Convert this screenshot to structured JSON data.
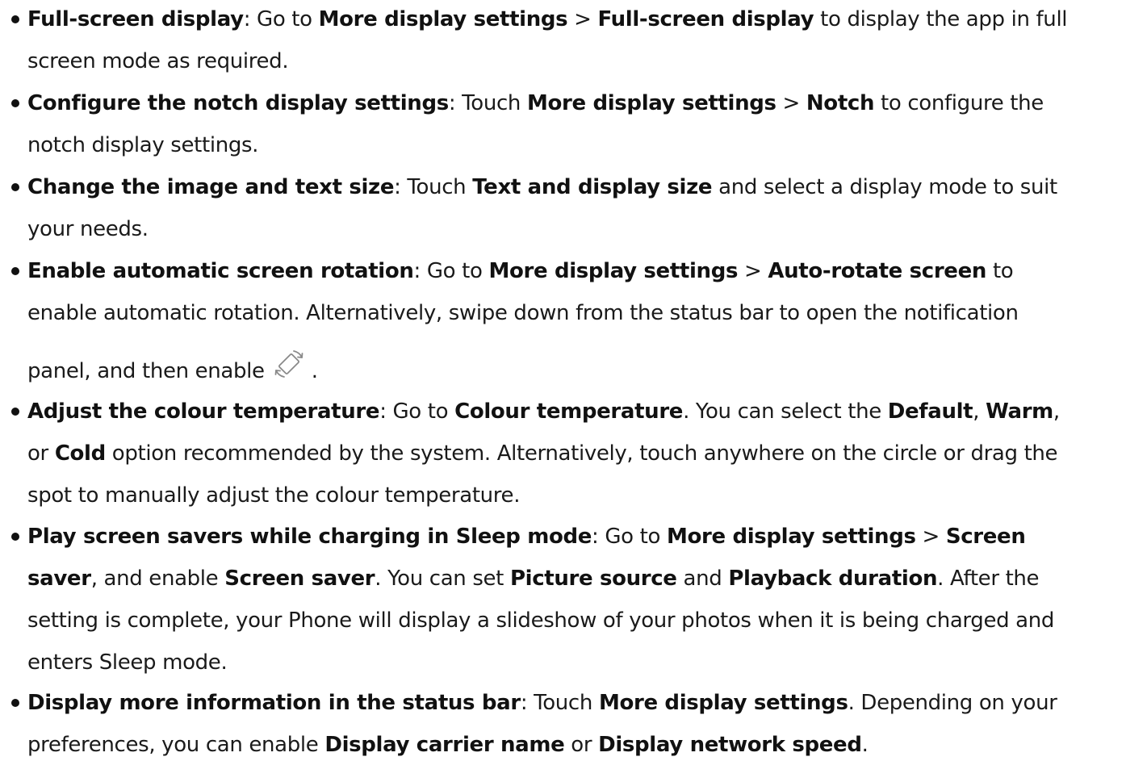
{
  "items": [
    {
      "id": "full-screen",
      "lines": [
        [
          {
            "t": "Full-screen display",
            "b": true
          },
          {
            "t": ": Go to "
          },
          {
            "t": "More display settings",
            "b": true
          },
          {
            "t": " > "
          },
          {
            "t": "Full-screen display",
            "b": true
          },
          {
            "t": " to display the app in full"
          }
        ],
        [
          {
            "t": "screen mode as required."
          }
        ]
      ]
    },
    {
      "id": "notch",
      "lines": [
        [
          {
            "t": "Configure the notch display settings",
            "b": true
          },
          {
            "t": ": Touch "
          },
          {
            "t": "More display settings",
            "b": true
          },
          {
            "t": " > "
          },
          {
            "t": "Notch",
            "b": true
          },
          {
            "t": " to configure the"
          }
        ],
        [
          {
            "t": "notch display settings."
          }
        ]
      ]
    },
    {
      "id": "text-size",
      "lines": [
        [
          {
            "t": "Change the image and text size",
            "b": true
          },
          {
            "t": ": Touch "
          },
          {
            "t": "Text and display size",
            "b": true
          },
          {
            "t": " and select a display mode to suit"
          }
        ],
        [
          {
            "t": "your needs."
          }
        ]
      ]
    },
    {
      "id": "auto-rotate",
      "lines": [
        [
          {
            "t": "Enable automatic screen rotation",
            "b": true
          },
          {
            "t": ": Go to "
          },
          {
            "t": "More display settings",
            "b": true
          },
          {
            "t": " > "
          },
          {
            "t": "Auto-rotate screen",
            "b": true
          },
          {
            "t": " to"
          }
        ],
        [
          {
            "t": "enable automatic rotation. Alternatively, swipe down from the status bar to open the notification"
          }
        ],
        [
          {
            "t": "panel, and then enable"
          },
          {
            "icon": "auto-rotate-icon"
          },
          {
            "t": "."
          }
        ]
      ]
    },
    {
      "id": "colour-temp",
      "lines": [
        [
          {
            "t": "Adjust the colour temperature",
            "b": true
          },
          {
            "t": ": Go to "
          },
          {
            "t": "Colour temperature",
            "b": true
          },
          {
            "t": ". You can select the "
          },
          {
            "t": "Default",
            "b": true
          },
          {
            "t": ", "
          },
          {
            "t": "Warm",
            "b": true
          },
          {
            "t": ","
          }
        ],
        [
          {
            "t": "or "
          },
          {
            "t": "Cold",
            "b": true
          },
          {
            "t": " option recommended by the system. Alternatively, touch anywhere on the circle or drag the"
          }
        ],
        [
          {
            "t": "spot to manually adjust the colour temperature."
          }
        ]
      ]
    },
    {
      "id": "screen-saver",
      "lines": [
        [
          {
            "t": "Play screen savers while charging in Sleep mode",
            "b": true
          },
          {
            "t": ": Go to "
          },
          {
            "t": "More display settings",
            "b": true
          },
          {
            "t": " > "
          },
          {
            "t": "Screen",
            "b": true
          }
        ],
        [
          {
            "t": "saver",
            "b": true
          },
          {
            "t": ", and enable "
          },
          {
            "t": "Screen saver",
            "b": true
          },
          {
            "t": ". You can set "
          },
          {
            "t": "Picture source",
            "b": true
          },
          {
            "t": " and "
          },
          {
            "t": "Playback duration",
            "b": true
          },
          {
            "t": ". After the"
          }
        ],
        [
          {
            "t": "setting is complete, your Phone will display a slideshow of your photos when it is being charged and"
          }
        ],
        [
          {
            "t": "enters Sleep mode."
          }
        ]
      ]
    },
    {
      "id": "status-bar",
      "lines": [
        [
          {
            "t": "Display more information in the status bar",
            "b": true
          },
          {
            "t": ": Touch "
          },
          {
            "t": "More display settings",
            "b": true
          },
          {
            "t": ". Depending on your"
          }
        ],
        [
          {
            "t": "preferences, you can enable "
          },
          {
            "t": "Display carrier name",
            "b": true
          },
          {
            "t": " or "
          },
          {
            "t": "Display network speed",
            "b": true
          },
          {
            "t": "."
          }
        ]
      ]
    }
  ]
}
